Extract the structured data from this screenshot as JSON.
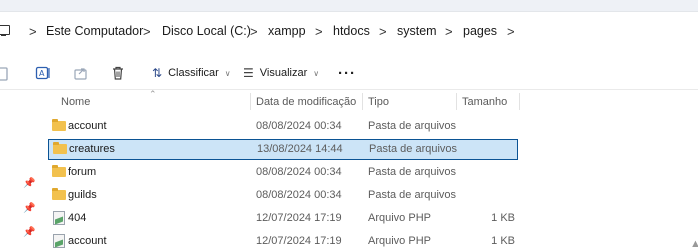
{
  "address": {
    "crumbs": [
      "Este Computador",
      "Disco Local (C:)",
      "xampp",
      "htdocs",
      "system",
      "pages"
    ],
    "separator": ">"
  },
  "toolbar": {
    "sort_label": "Classificar",
    "view_label": "Visualizar",
    "more_label": "···"
  },
  "columns": {
    "name": "Nome",
    "date": "Data de modificação",
    "type": "Tipo",
    "size": "Tamanho"
  },
  "files": [
    {
      "name": "account",
      "date": "08/08/2024 00:34",
      "type": "Pasta de arquivos",
      "size": "",
      "kind": "folder"
    },
    {
      "name": "creatures",
      "date": "13/08/2024 14:44",
      "type": "Pasta de arquivos",
      "size": "",
      "kind": "folder",
      "selected": true
    },
    {
      "name": "forum",
      "date": "08/08/2024 00:34",
      "type": "Pasta de arquivos",
      "size": "",
      "kind": "folder"
    },
    {
      "name": "guilds",
      "date": "08/08/2024 00:34",
      "type": "Pasta de arquivos",
      "size": "",
      "kind": "folder"
    },
    {
      "name": "404",
      "date": "12/07/2024 17:19",
      "type": "Arquivo PHP",
      "size": "1 KB",
      "kind": "php"
    },
    {
      "name": "account",
      "date": "12/07/2024 17:19",
      "type": "Arquivo PHP",
      "size": "1 KB",
      "kind": "php"
    }
  ],
  "colors": {
    "selection_bg": "#cce4f7",
    "selection_border": "#0b5394",
    "folder": "#f2c14e"
  }
}
